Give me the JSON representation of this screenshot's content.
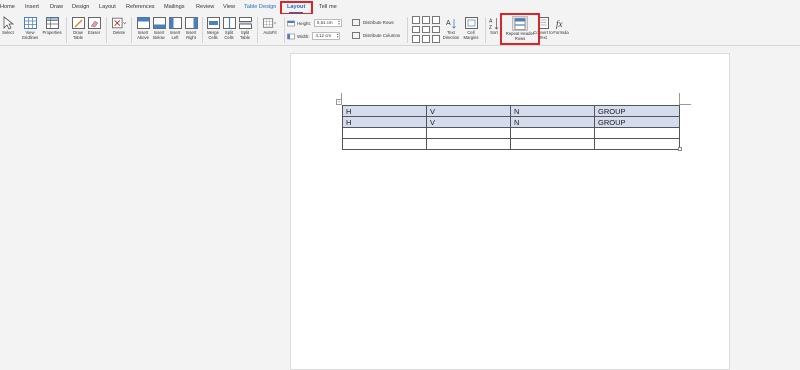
{
  "tabs": [
    "Home",
    "Insert",
    "Draw",
    "Design",
    "Layout",
    "References",
    "Mailings",
    "Review",
    "View",
    "Table Design",
    "Layout",
    "Tell me"
  ],
  "ribbon": {
    "select": "Select",
    "view_gridlines": "View Gridlines",
    "properties": "Properties",
    "draw_table": "Draw Table",
    "eraser": "Eraser",
    "delete": "Delete",
    "insert_above": "Insert Above",
    "insert_below": "Insert Below",
    "insert_left": "Insert Left",
    "insert_right": "Insert Right",
    "merge_cells": "Merge Cells",
    "split_cells": "Split Cells",
    "split_table": "Split Table",
    "autofit": "AutoFit",
    "height_label": "Height:",
    "height_value": "0,51 cm",
    "width_label": "Width:",
    "width_value": "4,12 cm",
    "distribute_rows": "Distribute Rows",
    "distribute_columns": "Distribute Columns",
    "text_direction": "Text Direction",
    "cell_margins": "Cell Margins",
    "sort": "Sort",
    "repeat_header_rows": "Repeat Header Rows",
    "convert_to_text": "Convert to Text",
    "formula": "Formula"
  },
  "document": {
    "table": [
      [
        "H",
        "V",
        "N",
        "GROUP"
      ],
      [
        "H",
        "V",
        "N",
        "GROUP"
      ],
      [
        "",
        "",
        "",
        ""
      ],
      [
        "",
        "",
        "",
        ""
      ]
    ]
  },
  "colors": {
    "accent": "#1e6fbf",
    "highlight": "#d9262b",
    "selected_row": "#d5dcee"
  }
}
